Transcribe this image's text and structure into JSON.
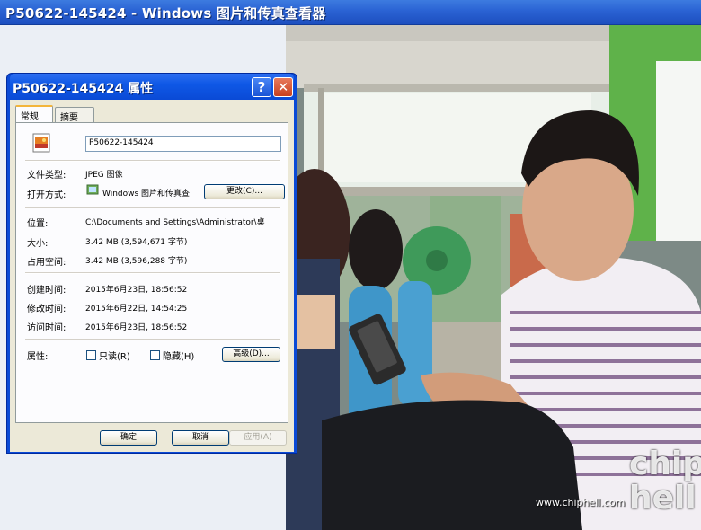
{
  "viewer": {
    "title": "P50622-145424 - Windows 图片和传真查看器"
  },
  "dialog": {
    "title": "P50622-145424 属性",
    "help_button": "?",
    "close_button": "✕",
    "tabs": [
      {
        "label": "常规",
        "active": true
      },
      {
        "label": "摘要",
        "active": false
      }
    ],
    "filename": "P50622-145424",
    "file_type": {
      "label": "文件类型:",
      "value": "JPEG 图像"
    },
    "opens_with": {
      "label": "打开方式:",
      "value": "Windows 图片和传真查",
      "change_button": "更改(C)..."
    },
    "location": {
      "label": "位置:",
      "value": "C:\\Documents and Settings\\Administrator\\桌"
    },
    "size": {
      "label": "大小:",
      "value": "3.42 MB (3,594,671 字节)"
    },
    "size_on_disk": {
      "label": "占用空间:",
      "value": "3.42 MB (3,596,288 字节)"
    },
    "created": {
      "label": "创建时间:",
      "value": "2015年6月23日, 18:56:52"
    },
    "modified": {
      "label": "修改时间:",
      "value": "2015年6月22日, 14:54:25"
    },
    "accessed": {
      "label": "访问时间:",
      "value": "2015年6月23日, 18:56:52"
    },
    "attributes": {
      "label": "属性:",
      "readonly_label": "只读(R)",
      "readonly_checked": false,
      "hidden_label": "隐藏(H)",
      "hidden_checked": false,
      "advanced_button": "高级(D)..."
    },
    "ok_button": "确定",
    "cancel_button": "取消",
    "apply_button": "应用(A)"
  },
  "photo": {
    "watermark_url": "www.chiphell.com",
    "watermark_logo_line1": "chip",
    "watermark_logo_line2": "hell"
  },
  "colors": {
    "xp_title_blue": "#0a4ad6",
    "dialog_face": "#ece9d8",
    "tab_highlight": "#f3b53b",
    "close_red": "#c8401f"
  }
}
